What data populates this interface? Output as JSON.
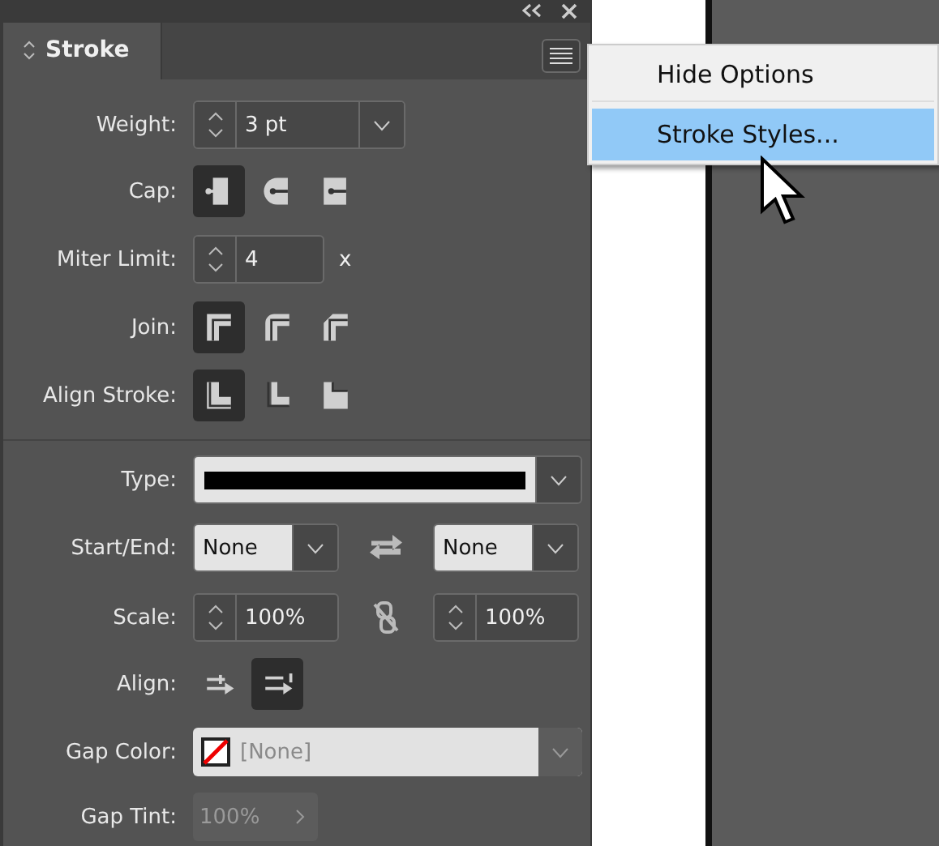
{
  "panel": {
    "title": "Stroke",
    "rows": [
      {
        "kind": "spinner-dropdown",
        "label": "Weight:",
        "value": "3 pt"
      },
      {
        "kind": "cap",
        "label": "Cap:",
        "options": [
          {
            "selected": true
          },
          {
            "selected": false
          },
          {
            "selected": false
          }
        ]
      },
      {
        "kind": "spinner",
        "label": "Miter Limit:",
        "value": "4",
        "suffix": "x"
      },
      {
        "kind": "join",
        "label": "Join:",
        "options": [
          {
            "selected": true
          },
          {
            "selected": false
          },
          {
            "selected": false
          }
        ]
      },
      {
        "kind": "align-stroke",
        "label": "Align Stroke:",
        "options": [
          {
            "selected": true
          },
          {
            "selected": false
          },
          {
            "selected": false
          }
        ]
      },
      {
        "kind": "divider"
      },
      {
        "kind": "type",
        "label": "Type:"
      },
      {
        "kind": "start-end",
        "label": "Start/End:",
        "start": "None",
        "end": "None"
      },
      {
        "kind": "scale",
        "label": "Scale:",
        "start": "100%",
        "end": "100%"
      },
      {
        "kind": "align",
        "label": "Align:",
        "options": [
          {
            "selected": false
          },
          {
            "selected": true
          }
        ]
      },
      {
        "kind": "gap-color",
        "label": "Gap Color:",
        "value": "[None]",
        "disabled": true
      },
      {
        "kind": "gap-tint",
        "label": "Gap Tint:",
        "value": "100%",
        "disabled": true
      }
    ]
  },
  "menu": {
    "items": [
      {
        "label": "Hide Options",
        "selected": false
      },
      {
        "label": "Stroke Styles...",
        "selected": true
      }
    ]
  }
}
